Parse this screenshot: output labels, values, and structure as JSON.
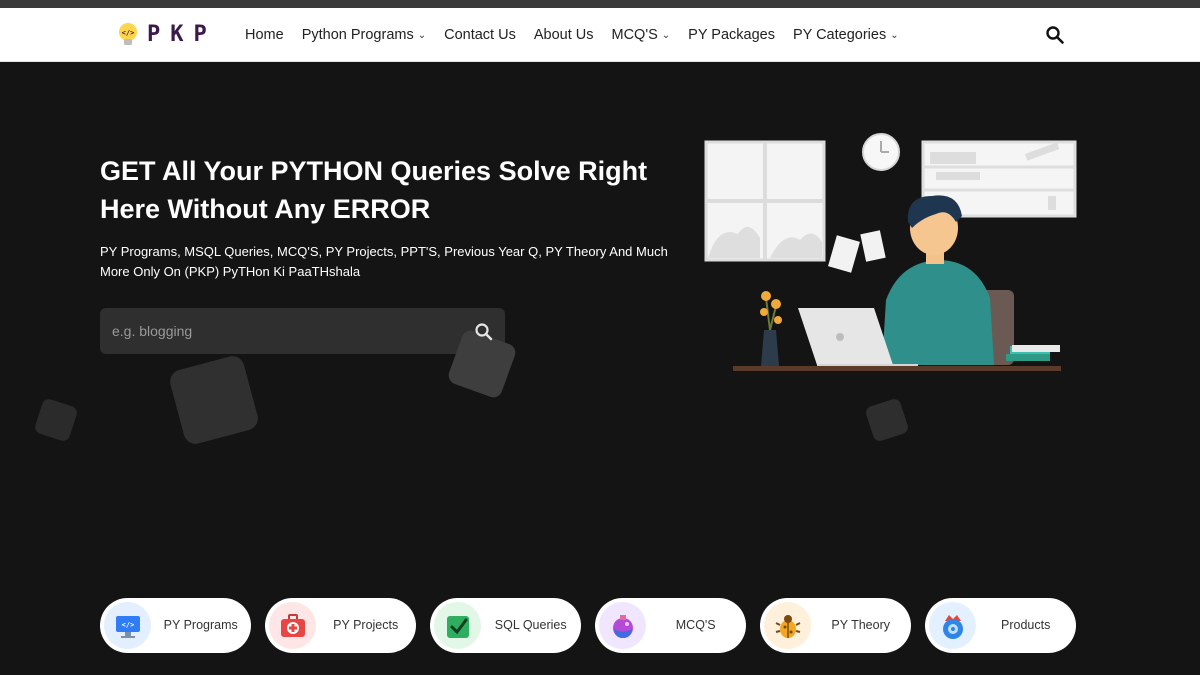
{
  "brand": {
    "logo_text": "PKP"
  },
  "nav": {
    "items": [
      {
        "label": "Home",
        "dropdown": false
      },
      {
        "label": "Python Programs",
        "dropdown": true
      },
      {
        "label": "Contact Us",
        "dropdown": false
      },
      {
        "label": "About Us",
        "dropdown": false
      },
      {
        "label": "MCQ'S",
        "dropdown": true
      },
      {
        "label": "PY Packages",
        "dropdown": false
      },
      {
        "label": "PY Categories",
        "dropdown": true
      }
    ]
  },
  "hero": {
    "title": "GET All Your PYTHON Queries Solve Right Here Without Any ERROR",
    "subtitle": "PY Programs, MSQL Queries, MCQ'S, PY Projects, PPT'S, Previous Year Q, PY Theory And Much More Only On (PKP) PyTHon Ki PaaTHshala",
    "search_placeholder": "e.g. blogging"
  },
  "categories": [
    {
      "label": "PY Programs",
      "icon": "monitor-code-icon",
      "bg": "#e3efff"
    },
    {
      "label": "PY Projects",
      "icon": "medical-kit-icon",
      "bg": "#ffe6e6"
    },
    {
      "label": "SQL Queries",
      "icon": "checkbox-icon",
      "bg": "#e2f7e7"
    },
    {
      "label": "MCQ'S",
      "icon": "magic-potion-icon",
      "bg": "#f1e6ff"
    },
    {
      "label": "PY Theory",
      "icon": "bug-icon",
      "bg": "#fff0dc"
    },
    {
      "label": "Products",
      "icon": "disc-icon",
      "bg": "#e3f0ff"
    }
  ],
  "colors": {
    "background": "#141414",
    "navbar": "#ffffff",
    "accent": "#3b1a4a"
  }
}
